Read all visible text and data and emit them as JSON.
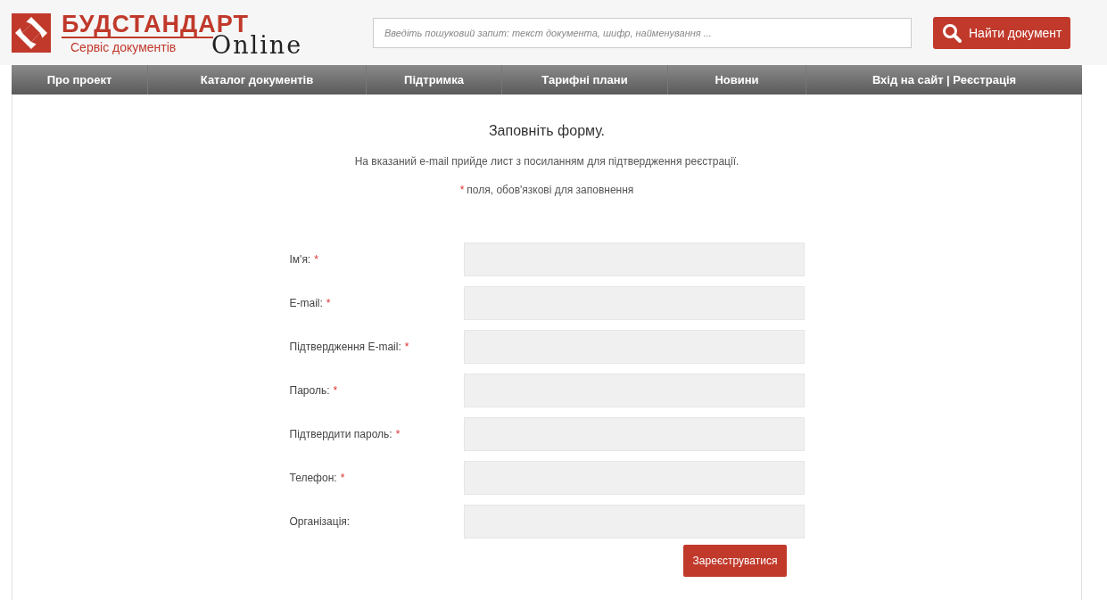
{
  "logo": {
    "title": "БУДСТАНДАРТ",
    "subtitle": "Сервіс документів",
    "online": "Online"
  },
  "search": {
    "placeholder": "Введіть пошуковий запит: текст документа, шифр, найменування ...",
    "button": "Найти документ"
  },
  "nav": [
    "Про проект",
    "Каталог документів",
    "Підтримка",
    "Тарифні плани",
    "Новини",
    "Вхід на сайт | Реєстрація"
  ],
  "form": {
    "title": "Заповніть форму.",
    "info": "На вказаний e-mail прийде лист з посиланням для підтвердження реєстрації.",
    "note": {
      "mark": "*",
      "text": "поля, обов'язкові для заповнення"
    },
    "fields": [
      {
        "label": "Ім'я:",
        "mark": "*"
      },
      {
        "label": "E-mail:",
        "mark": "*"
      },
      {
        "label": "Підтвердження E-mail:",
        "mark": "*"
      },
      {
        "label": "Пароль:",
        "mark": "*"
      },
      {
        "label": "Підтвердити пароль:",
        "mark": "*"
      },
      {
        "label": "Телефон:",
        "mark": "*"
      },
      {
        "label": "Організація:"
      }
    ],
    "submit": "Зареєструватися"
  }
}
